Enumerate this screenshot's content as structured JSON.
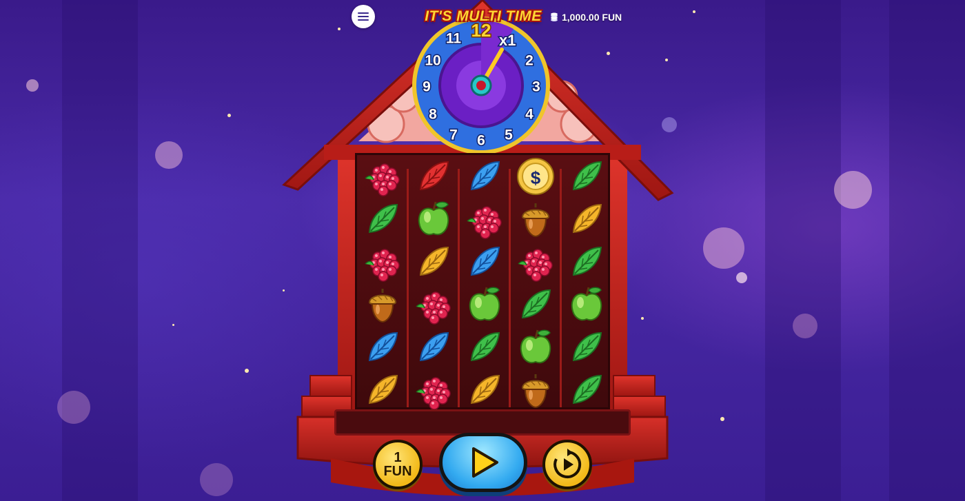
{
  "header": {
    "menu_icon": "hamburger-menu-icon",
    "balance_icon": "coin-stack-icon",
    "balance_text": "1,000.00 FUN"
  },
  "game": {
    "title": "IT'S MULTI TIME",
    "clock": {
      "numbers": [
        "12",
        "1",
        "2",
        "3",
        "4",
        "5",
        "6",
        "7",
        "8",
        "9",
        "10",
        "11"
      ],
      "multiplier": "x1",
      "hand_position": 1
    },
    "reels": [
      [
        "raspberry",
        "green-leaf",
        "raspberry",
        "acorn",
        "blue-leaf",
        "gold-leaf"
      ],
      [
        "red-leaf",
        "green-apple",
        "gold-leaf",
        "raspberry",
        "blue-leaf",
        "raspberry"
      ],
      [
        "blue-leaf",
        "raspberry",
        "blue-leaf",
        "green-apple",
        "green-leaf",
        "gold-leaf"
      ],
      [
        "dollar-coin",
        "acorn",
        "raspberry",
        "green-leaf",
        "green-apple",
        "acorn"
      ],
      [
        "green-leaf",
        "gold-leaf",
        "green-leaf",
        "green-apple",
        "green-leaf",
        "green-leaf"
      ]
    ]
  },
  "controls": {
    "bet_amount": "1",
    "bet_currency": "FUN",
    "spin_icon": "play-icon",
    "autoplay_icon": "autoplay-icon"
  },
  "colors": {
    "background": "#3b1e93",
    "house_red": "#c8231f",
    "button_gold": "#f2b918",
    "spin_blue": "#33aaf0",
    "clock_rim": "#2f6fe0",
    "clock_face": "#6b1fc4"
  }
}
